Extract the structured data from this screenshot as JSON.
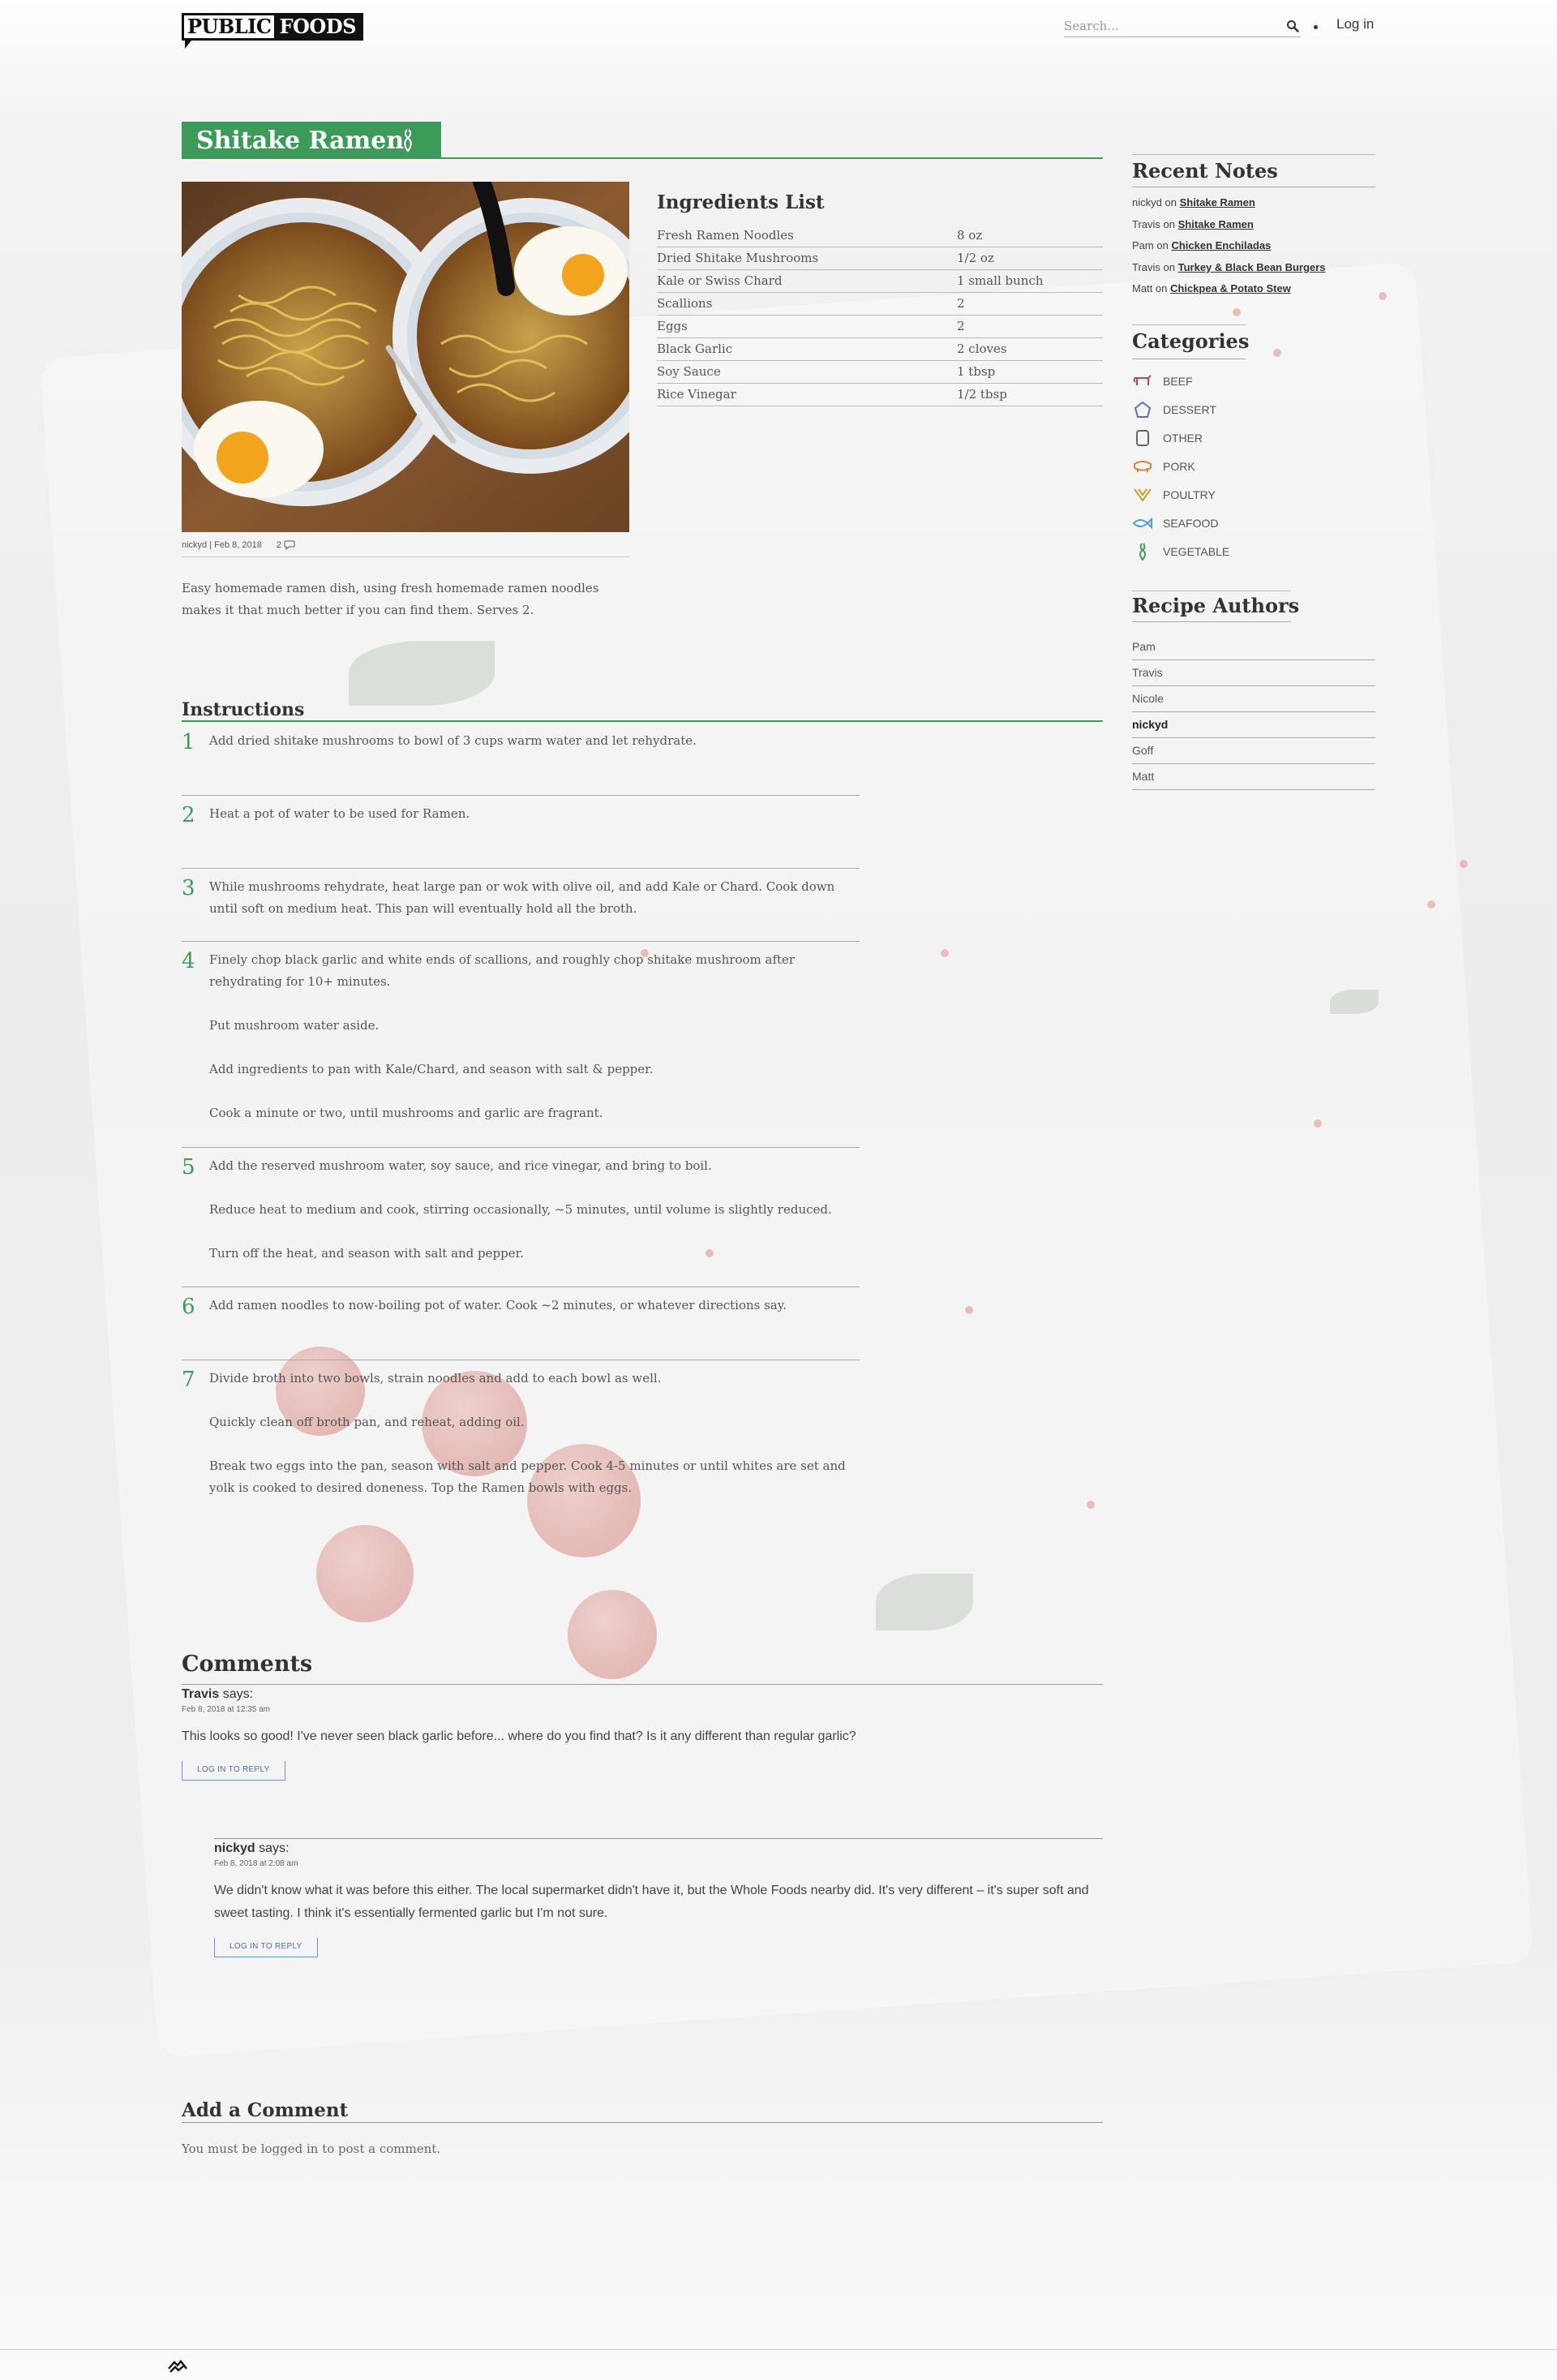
{
  "header": {
    "logo_left": "PUBLIC",
    "logo_right": "FOODS",
    "search_placeholder": "Search...",
    "login_label": "Log in"
  },
  "recipe": {
    "title": "Shitake Ramen",
    "category_icon": "vegetable-icon",
    "author": "nickyd",
    "date": "Feb 8, 2018",
    "comment_count": "2",
    "description": "Easy homemade ramen dish, using fresh homemade ramen noodles makes it that much better if you can find them. Serves 2."
  },
  "ingredients": {
    "title": "Ingredients List",
    "items": [
      {
        "name": "Fresh Ramen Noodles",
        "amount": "8 oz"
      },
      {
        "name": "Dried Shitake Mushrooms",
        "amount": "1/2 oz"
      },
      {
        "name": "Kale or Swiss Chard",
        "amount": "1 small bunch"
      },
      {
        "name": "Scallions",
        "amount": "2"
      },
      {
        "name": "Eggs",
        "amount": "2"
      },
      {
        "name": "Black Garlic",
        "amount": "2 cloves"
      },
      {
        "name": "Soy Sauce",
        "amount": "1 tbsp"
      },
      {
        "name": "Rice Vinegar",
        "amount": "1/2 tbsp"
      }
    ]
  },
  "instructions": {
    "title": "Instructions",
    "steps": [
      {
        "num": "1",
        "paras": [
          "Add dried shitake mushrooms to bowl of 3 cups warm water and let rehydrate."
        ]
      },
      {
        "num": "2",
        "paras": [
          "Heat a pot of water to be used for Ramen."
        ]
      },
      {
        "num": "3",
        "paras": [
          "While mushrooms rehydrate, heat large pan or wok with olive oil, and add Kale or Chard. Cook down until soft on medium heat. This pan will eventually hold all the broth."
        ]
      },
      {
        "num": "4",
        "paras": [
          "Finely chop black garlic and white ends of scallions, and roughly chop shitake mushroom after rehydrating for 10+ minutes.",
          "Put mushroom water aside.",
          "Add ingredients to pan with Kale/Chard, and season with salt & pepper.",
          "Cook a minute or two, until mushrooms and garlic are fragrant."
        ]
      },
      {
        "num": "5",
        "paras": [
          "Add the reserved mushroom water, soy sauce, and rice vinegar, and bring to boil.",
          "Reduce heat to medium and cook, stirring occasionally, ~5 minutes, until volume is slightly reduced.",
          "Turn off the heat, and season with salt and pepper."
        ]
      },
      {
        "num": "6",
        "paras": [
          "Add ramen noodles to now-boiling pot of water. Cook ~2 minutes, or whatever directions say."
        ]
      },
      {
        "num": "7",
        "paras": [
          "Divide broth into two bowls, strain noodles and add to each bowl as well.",
          "Quickly clean off broth pan, and reheat, adding oil.",
          "Break two eggs into the pan, season with salt and pepper. Cook 4-5 minutes or until whites are set and yolk is cooked to desired doneness. Top the Ramen bowls with eggs."
        ]
      }
    ]
  },
  "comments": {
    "title": "Comments",
    "says": "says:",
    "items": [
      {
        "author": "Travis",
        "date": "Feb 8, 2018 at 12:35 am",
        "text": "This looks so good! I've never seen black garlic before... where do you find that? Is it any different than regular garlic?",
        "reply_label": "LOG IN TO REPLY"
      },
      {
        "author": "nickyd",
        "date": "Feb 8, 2018 at 2:08 am",
        "text": "We didn't know what it was before this either. The local supermarket didn't have it, but the Whole Foods nearby did. It's very different – it's super soft and sweet tasting. I think it's essentially fermented garlic but I'm not sure.",
        "reply_label": "LOG IN TO REPLY"
      }
    ]
  },
  "add_comment": {
    "title": "Add a Comment",
    "note_prefix": "You must be ",
    "note_link": "logged in",
    "note_suffix": " to post a comment."
  },
  "sidebar": {
    "recent_notes": {
      "title": "Recent Notes",
      "on": "on",
      "items": [
        {
          "user": "nickyd",
          "recipe": "Shitake Ramen"
        },
        {
          "user": "Travis",
          "recipe": "Shitake Ramen"
        },
        {
          "user": "Pam",
          "recipe": "Chicken Enchiladas"
        },
        {
          "user": "Travis",
          "recipe": "Turkey & Black Bean Burgers"
        },
        {
          "user": "Matt",
          "recipe": "Chickpea & Potato Stew"
        }
      ]
    },
    "categories": {
      "title": "Categories",
      "items": [
        {
          "label": "BEEF",
          "icon": "beef-icon",
          "color": "#c0464a"
        },
        {
          "label": "DESSERT",
          "icon": "dessert-icon",
          "color": "#5f6fc0"
        },
        {
          "label": "OTHER",
          "icon": "other-icon",
          "color": "#666666"
        },
        {
          "label": "PORK",
          "icon": "pork-icon",
          "color": "#e0803a"
        },
        {
          "label": "POULTRY",
          "icon": "poultry-icon",
          "color": "#c7a12a"
        },
        {
          "label": "SEAFOOD",
          "icon": "seafood-icon",
          "color": "#4aa3d8"
        },
        {
          "label": "VEGETABLE",
          "icon": "vegetable-icon",
          "color": "#3d9b5a"
        }
      ]
    },
    "authors": {
      "title": "Recipe Authors",
      "items": [
        "Pam",
        "Travis",
        "Nicole",
        "nickyd",
        "Goff",
        "Matt"
      ],
      "active": "nickyd"
    }
  },
  "colors": {
    "accent_green": "#3d9b5a",
    "reply_blue": "#4b6cc4"
  }
}
